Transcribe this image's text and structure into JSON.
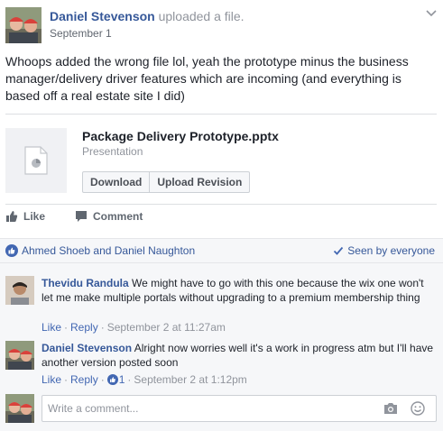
{
  "post": {
    "author": "Daniel Stevenson",
    "action": "uploaded a file.",
    "time": "September 1",
    "text": "Whoops added the wrong file lol, yeah the prototype minus the business manager/delivery driver features which are incoming (and everything is based off a real estate site I did)"
  },
  "attachment": {
    "file_name": "Package Delivery Prototype.pptx",
    "file_type": "Presentation",
    "download_label": "Download",
    "upload_label": "Upload Revision"
  },
  "actions": {
    "like_label": "Like",
    "comment_label": "Comment"
  },
  "feedback": {
    "likers": "Ahmed Shoeb and Daniel Naughton",
    "seen": "Seen by everyone"
  },
  "comments": [
    {
      "author": "Thevidu Randula",
      "text": "We might have to go with this one because the wix one won't let me make multiple portals without upgrading to a premium membership thing",
      "like_label": "Like",
      "reply_label": "Reply",
      "time": "September 2 at 11:27am"
    },
    {
      "author": "Daniel Stevenson",
      "text": "Alright now worries well it's a work in progress atm but I'll have another version posted soon",
      "like_label": "Like",
      "reply_label": "Reply",
      "reaction_count": "1",
      "time": "September 2 at 1:12pm"
    }
  ],
  "composer": {
    "placeholder": "Write a comment..."
  },
  "colors": {
    "link": "#365899",
    "accent": "#4267b2",
    "meta": "#90949c",
    "panel": "#f6f7f9"
  },
  "icons": [
    "chevron-down-icon",
    "presentation-file-icon",
    "thumbs-up-icon",
    "comment-bubble-icon",
    "like-reaction-icon",
    "checkmark-icon",
    "camera-icon",
    "emoji-icon"
  ]
}
